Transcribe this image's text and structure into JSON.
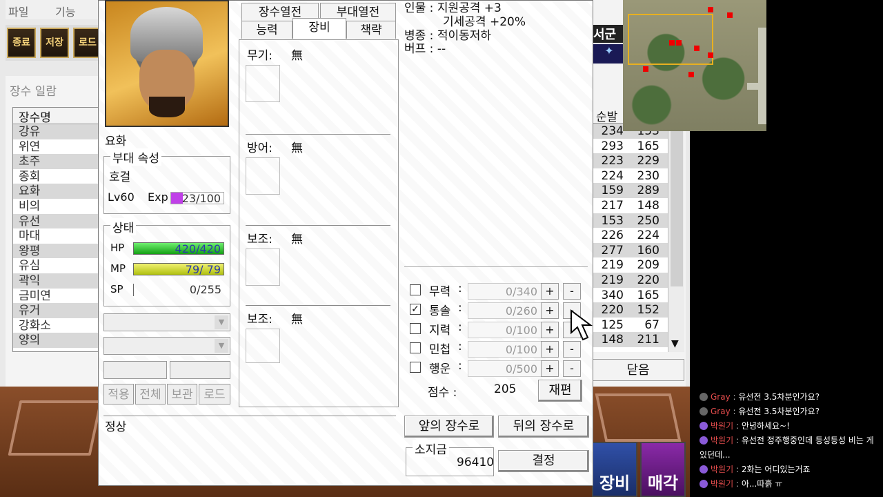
{
  "menu": [
    "파일",
    "기능"
  ],
  "toolbar": [
    "종료",
    "저장",
    "로드"
  ],
  "list_title": "장수 일람",
  "generals": {
    "header": "장수명",
    "names": [
      "강유",
      "위연",
      "초주",
      "종회",
      "요화",
      "비의",
      "유선",
      "마대",
      "왕평",
      "유심",
      "곽익",
      "금미연",
      "유거",
      "강화소",
      "양의"
    ]
  },
  "stats": {
    "header": "순발",
    "rows": [
      [
        "234",
        "153"
      ],
      [
        "293",
        "165"
      ],
      [
        "223",
        "229"
      ],
      [
        "224",
        "230"
      ],
      [
        "159",
        "289"
      ],
      [
        "217",
        "148"
      ],
      [
        "153",
        "250"
      ],
      [
        "226",
        "224"
      ],
      [
        "277",
        "160"
      ],
      [
        "219",
        "209"
      ],
      [
        "219",
        "220"
      ],
      [
        "340",
        "165"
      ],
      [
        "220",
        "152"
      ],
      [
        "125",
        "67"
      ],
      [
        "148",
        "211"
      ]
    ]
  },
  "close_label": "닫음",
  "unit_name": "서군",
  "bottom_icons": [
    "장비",
    "매각"
  ],
  "general": {
    "name": "요화",
    "unit_group": "부대 속성",
    "unit_type": "호걸",
    "level": "Lv60",
    "exp_label": "Exp",
    "exp": "23/100",
    "exp_fraction": 0.23,
    "status_group": "상태",
    "hp_label": "HP",
    "hp": "420/420",
    "hp_fraction": 1.0,
    "mp_label": "MP",
    "mp": "79/ 79",
    "mp_fraction": 1.0,
    "sp_label": "SP",
    "sp": "0/255",
    "sp_fraction": 0.0
  },
  "buttons": {
    "apply": "적용",
    "all": "전체",
    "store": "보관",
    "load": "로드"
  },
  "condition": "정상",
  "tabs": {
    "row1": [
      "장수열전",
      "부대열전"
    ],
    "row2": [
      "능력",
      "장비",
      "책략"
    ],
    "active": "장비"
  },
  "equipment": [
    {
      "label": "무기:",
      "value": "無"
    },
    {
      "label": "방어:",
      "value": "無"
    },
    {
      "label": "보조:",
      "value": "無"
    },
    {
      "label": "보조:",
      "value": "無"
    }
  ],
  "info": {
    "line1": "인물 : 지원공격 +3",
    "line2": "기세공격 +20%",
    "line3": "병종 : 적이동저하",
    "line4": "버프 : --"
  },
  "upgrades": [
    {
      "label": "무력",
      "value": "0/340",
      "checked": false
    },
    {
      "label": "통솔",
      "value": "0/260",
      "checked": true
    },
    {
      "label": "지력",
      "value": "0/100",
      "checked": false
    },
    {
      "label": "민첩",
      "value": "0/100",
      "checked": false
    },
    {
      "label": "행운",
      "value": "0/500",
      "checked": false
    }
  ],
  "plus": "+",
  "minus": "-",
  "colon": ":",
  "score_label": "점수 :",
  "score": "205",
  "reorg": "재편",
  "prev_general": "앞의 장수로",
  "next_general": "뒤의 장수로",
  "gold_label": "소지금",
  "gold": "96410",
  "decide": "결정",
  "chat": [
    {
      "badge": "G",
      "name": "Gray",
      "text": "유선전 3.5차분인가요?",
      "type": "g"
    },
    {
      "badge": "G",
      "name": "Gray",
      "text": "유선전 3.5차분인가요?",
      "type": "g"
    },
    {
      "badge": "회",
      "name": "박원기",
      "text": "안녕하세요~!",
      "type": "p"
    },
    {
      "badge": "회",
      "name": "박원기",
      "text": "유선전 정주행중인데 등성등성 비는 게 있던데...",
      "type": "p"
    },
    {
      "badge": "회",
      "name": "박원기",
      "text": "2화는 어디있는거죠",
      "type": "p"
    },
    {
      "badge": "회",
      "name": "박원기",
      "text": "아...따흙 ㅠ",
      "type": "p"
    }
  ],
  "colors": {
    "hp": "#22c02a",
    "mp": "#c8d81a",
    "exp": "#c040e8",
    "minimap_frame": "#e8b020"
  }
}
